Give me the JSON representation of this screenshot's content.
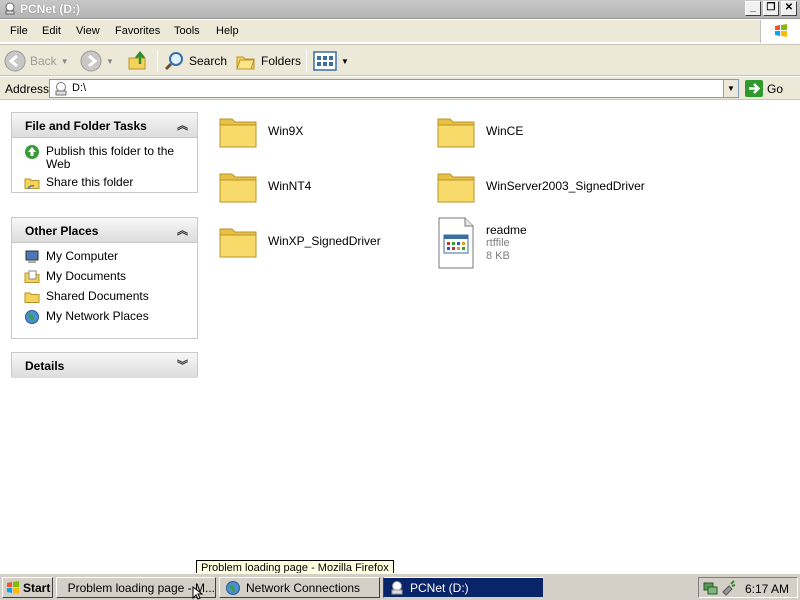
{
  "window": {
    "title": "PCNet (D:)"
  },
  "titlebar_buttons": {
    "minimize": "_",
    "maximize": "❐",
    "close": "✕"
  },
  "menu": [
    "File",
    "Edit",
    "View",
    "Favorites",
    "Tools",
    "Help"
  ],
  "toolbar": {
    "back": "Back",
    "search": "Search",
    "folders": "Folders"
  },
  "address": {
    "label": "Address",
    "value": "D:\\",
    "go": "Go"
  },
  "panels": {
    "file_tasks": {
      "title": "File and Folder Tasks",
      "items": [
        "Publish this folder to the Web",
        "Share this folder"
      ]
    },
    "other_places": {
      "title": "Other Places",
      "items": [
        "My Computer",
        "My Documents",
        "Shared Documents",
        "My Network Places"
      ]
    },
    "details": {
      "title": "Details"
    }
  },
  "files": [
    {
      "name": "Win9X",
      "type": "folder"
    },
    {
      "name": "WinCE",
      "type": "folder"
    },
    {
      "name": "WinNT4",
      "type": "folder"
    },
    {
      "name": "WinServer2003_SignedDriver",
      "type": "folder"
    },
    {
      "name": "WinXP_SignedDriver",
      "type": "folder"
    },
    {
      "name": "readme",
      "type": "file",
      "subtype": "rtffile",
      "size": "8 KB"
    }
  ],
  "tooltip": "Problem loading page - Mozilla Firefox",
  "taskbar": {
    "start": "Start",
    "tasks": [
      "Problem loading page - M...",
      "Network Connections",
      "PCNet (D:)"
    ],
    "clock": "6:17 AM"
  },
  "colors": {
    "taskbar_active": "#0a246a",
    "folder": "#f5d35b",
    "panel_bg": "#ffffff"
  }
}
